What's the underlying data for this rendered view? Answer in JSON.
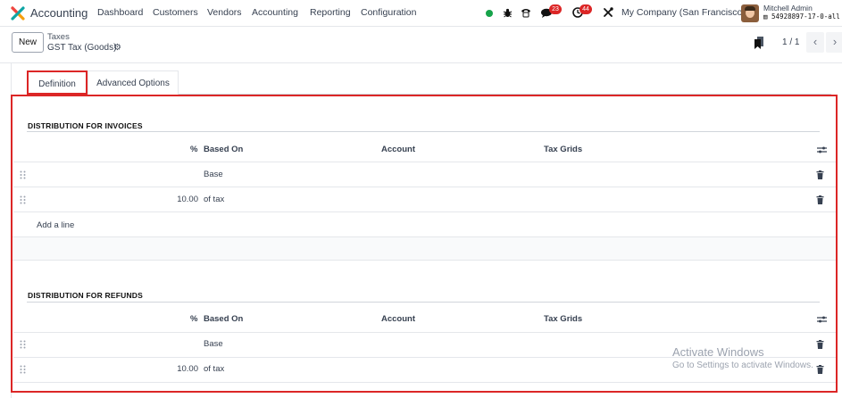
{
  "navbar": {
    "app_name": "Accounting",
    "menu": [
      "Dashboard",
      "Customers",
      "Vendors",
      "Accounting",
      "Reporting",
      "Configuration"
    ],
    "messages_count": "23",
    "activities_count": "44",
    "company": "My Company (San Francisco)",
    "user_name": "Mitchell Admin",
    "database": "54928897-17-0-all"
  },
  "control": {
    "new_label": "New",
    "breadcrumb_parent": "Taxes",
    "breadcrumb_current": "GST Tax (Goods)",
    "pager": "1 / 1"
  },
  "tabs": [
    "Definition",
    "Advanced Options"
  ],
  "invoices": {
    "title": "DISTRIBUTION FOR INVOICES",
    "columns": [
      "%",
      "Based On",
      "Account",
      "Tax Grids"
    ],
    "rows": [
      {
        "percent": "",
        "based_on": "Base"
      },
      {
        "percent": "10.00",
        "based_on": "of tax"
      }
    ],
    "add_line": "Add a line"
  },
  "refunds": {
    "title": "DISTRIBUTION FOR REFUNDS",
    "columns": [
      "%",
      "Based On",
      "Account",
      "Tax Grids"
    ],
    "rows": [
      {
        "percent": "",
        "based_on": "Base"
      },
      {
        "percent": "10.00",
        "based_on": "of tax"
      }
    ]
  },
  "watermark": {
    "title": "Activate Windows",
    "subtitle": "Go to Settings to activate Windows."
  },
  "colors": {
    "highlight": "#dc2626",
    "status_online": "#16a34a"
  }
}
